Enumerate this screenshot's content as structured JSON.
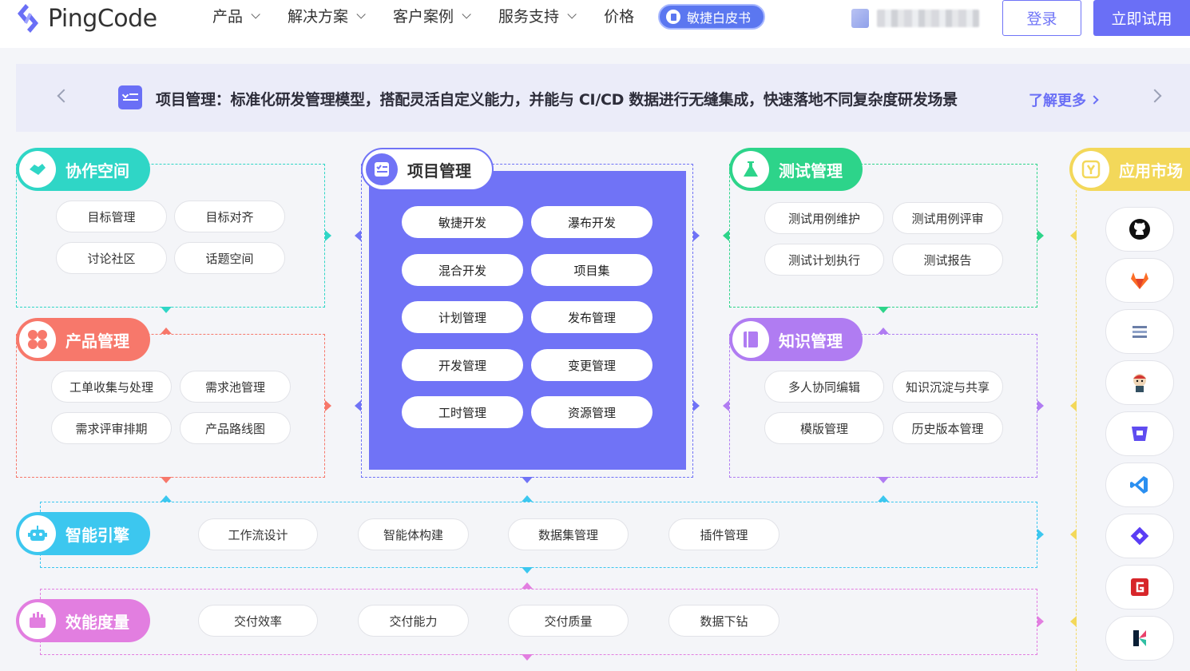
{
  "header": {
    "logo_text": "PingCode",
    "nav": [
      {
        "label": "产品",
        "dropdown": true
      },
      {
        "label": "解决方案",
        "dropdown": true
      },
      {
        "label": "客户案例",
        "dropdown": true
      },
      {
        "label": "服务支持",
        "dropdown": true
      },
      {
        "label": "价格",
        "dropdown": false
      }
    ],
    "whitepaper_label": "敏捷白皮书",
    "login_label": "登录",
    "trial_label": "立即试用"
  },
  "banner": {
    "text": "项目管理：标准化研发管理模型，搭配灵活自定义能力，并能与 CI/CD 数据进行无缝集成，快速落地不同复杂度研发场景",
    "more_label": "了解更多"
  },
  "modules": {
    "collab": {
      "title": "协作空间",
      "color": "#2fd6c6",
      "items": [
        "目标管理",
        "目标对齐",
        "讨论社区",
        "话题空间"
      ]
    },
    "product": {
      "title": "产品管理",
      "color": "#f7786b",
      "items": [
        "工单收集与处理",
        "需求池管理",
        "需求评审排期",
        "产品路线图"
      ]
    },
    "project": {
      "title": "项目管理",
      "color": "#7073f6",
      "items": [
        "敏捷开发",
        "瀑布开发",
        "混合开发",
        "项目集",
        "计划管理",
        "发布管理",
        "开发管理",
        "变更管理",
        "工时管理",
        "资源管理"
      ]
    },
    "testing": {
      "title": "测试管理",
      "color": "#2dd48a",
      "items": [
        "测试用例维护",
        "测试用例评审",
        "测试计划执行",
        "测试报告"
      ]
    },
    "knowledge": {
      "title": "知识管理",
      "color": "#b07cf2",
      "items": [
        "多人协同编辑",
        "知识沉淀与共享",
        "模版管理",
        "历史版本管理"
      ]
    },
    "ai": {
      "title": "智能引擎",
      "color": "#3cc7ef",
      "items": [
        "工作流设计",
        "智能体构建",
        "数据集管理",
        "插件管理"
      ]
    },
    "metrics": {
      "title": "效能度量",
      "color": "#e27ee0",
      "items": [
        "交付效率",
        "交付能力",
        "交付质量",
        "数据下钻"
      ]
    },
    "market": {
      "title": "应用市场",
      "color": "#f3d85a",
      "apps": [
        "github-icon",
        "gitlab-icon",
        "zentao-icon",
        "jenkins-icon",
        "bitbucket-icon",
        "vscode-icon",
        "jira-icon",
        "gitee-icon",
        "kubernetes-icon"
      ]
    }
  }
}
